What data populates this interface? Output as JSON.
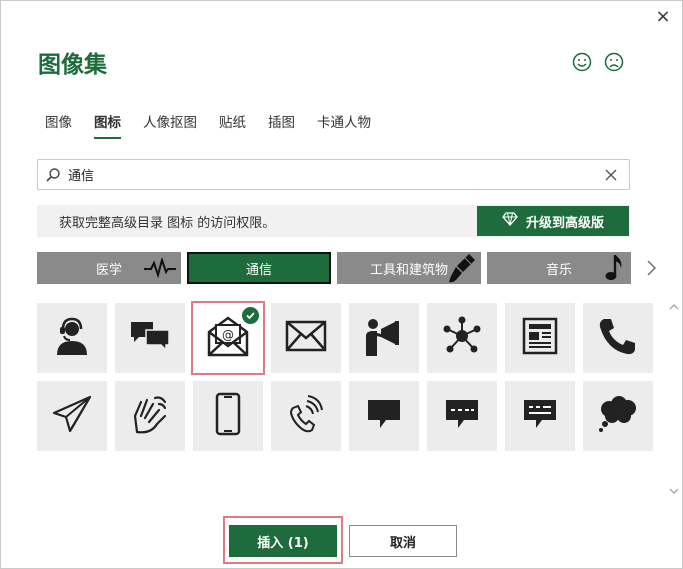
{
  "dialog": {
    "title": "图像集",
    "close_label": "×"
  },
  "tabs": [
    {
      "label": "图像",
      "active": false
    },
    {
      "label": "图标",
      "active": true
    },
    {
      "label": "人像抠图",
      "active": false
    },
    {
      "label": "贴纸",
      "active": false
    },
    {
      "label": "插图",
      "active": false
    },
    {
      "label": "卡通人物",
      "active": false
    }
  ],
  "search": {
    "value": "通信",
    "icon": "search-icon",
    "clear_icon": "clear-icon"
  },
  "banner": {
    "text": "获取完整高级目录 图标 的访问权限。",
    "upgrade_label": "升级到高级版",
    "upgrade_icon": "diamond-icon"
  },
  "categories": [
    {
      "label": "医学",
      "icon": "heartbeat-icon",
      "active": false
    },
    {
      "label": "通信",
      "icon": "",
      "active": true
    },
    {
      "label": "工具和建筑物",
      "icon": "brush-icon",
      "active": false
    },
    {
      "label": "音乐",
      "icon": "music-note-icon",
      "active": false
    }
  ],
  "icons": [
    {
      "name": "customer-support-icon",
      "selected": false
    },
    {
      "name": "chat-bubbles-icon",
      "selected": false
    },
    {
      "name": "open-email-icon",
      "selected": true
    },
    {
      "name": "envelope-icon",
      "selected": false
    },
    {
      "name": "megaphone-person-icon",
      "selected": false
    },
    {
      "name": "network-icon",
      "selected": false
    },
    {
      "name": "newspaper-icon",
      "selected": false
    },
    {
      "name": "phone-handset-icon",
      "selected": false
    },
    {
      "name": "paper-plane-icon",
      "selected": false
    },
    {
      "name": "sign-language-icon",
      "selected": false
    },
    {
      "name": "mobile-phone-icon",
      "selected": false
    },
    {
      "name": "phone-ringing-icon",
      "selected": false
    },
    {
      "name": "speech-bubble-icon",
      "selected": false
    },
    {
      "name": "message-dashes-icon",
      "selected": false
    },
    {
      "name": "message-lines-icon",
      "selected": false
    },
    {
      "name": "thought-bubble-icon",
      "selected": false
    }
  ],
  "footer": {
    "insert_label": "插入 (1)",
    "cancel_label": "取消"
  },
  "colors": {
    "accent": "#1e6b3c",
    "category_inactive": "#8a8a8a",
    "selection_outline": "#e07a83"
  }
}
